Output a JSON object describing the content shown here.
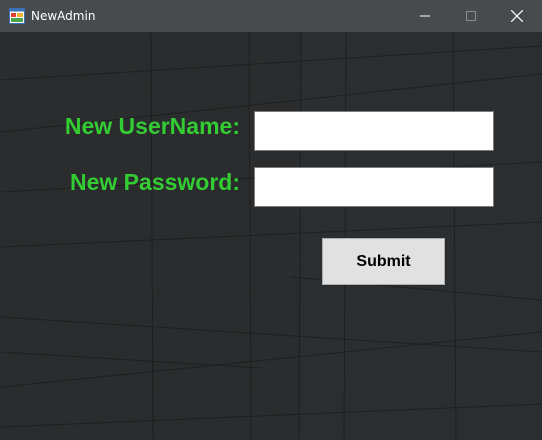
{
  "window": {
    "title": "NewAdmin",
    "icon": "winforms-app-icon",
    "controls": {
      "minimize_icon": "minimize-icon",
      "maximize_icon": "maximize-icon",
      "close_icon": "close-icon"
    }
  },
  "form": {
    "username_label": "New UserName:",
    "username_value": "",
    "password_label": "New Password:",
    "password_value": "",
    "submit_label": "Submit"
  },
  "colors": {
    "label_green": "#33cc33",
    "titlebar": "#484b4e",
    "background": "#2b2e30",
    "button_face": "#e1e1e1"
  }
}
